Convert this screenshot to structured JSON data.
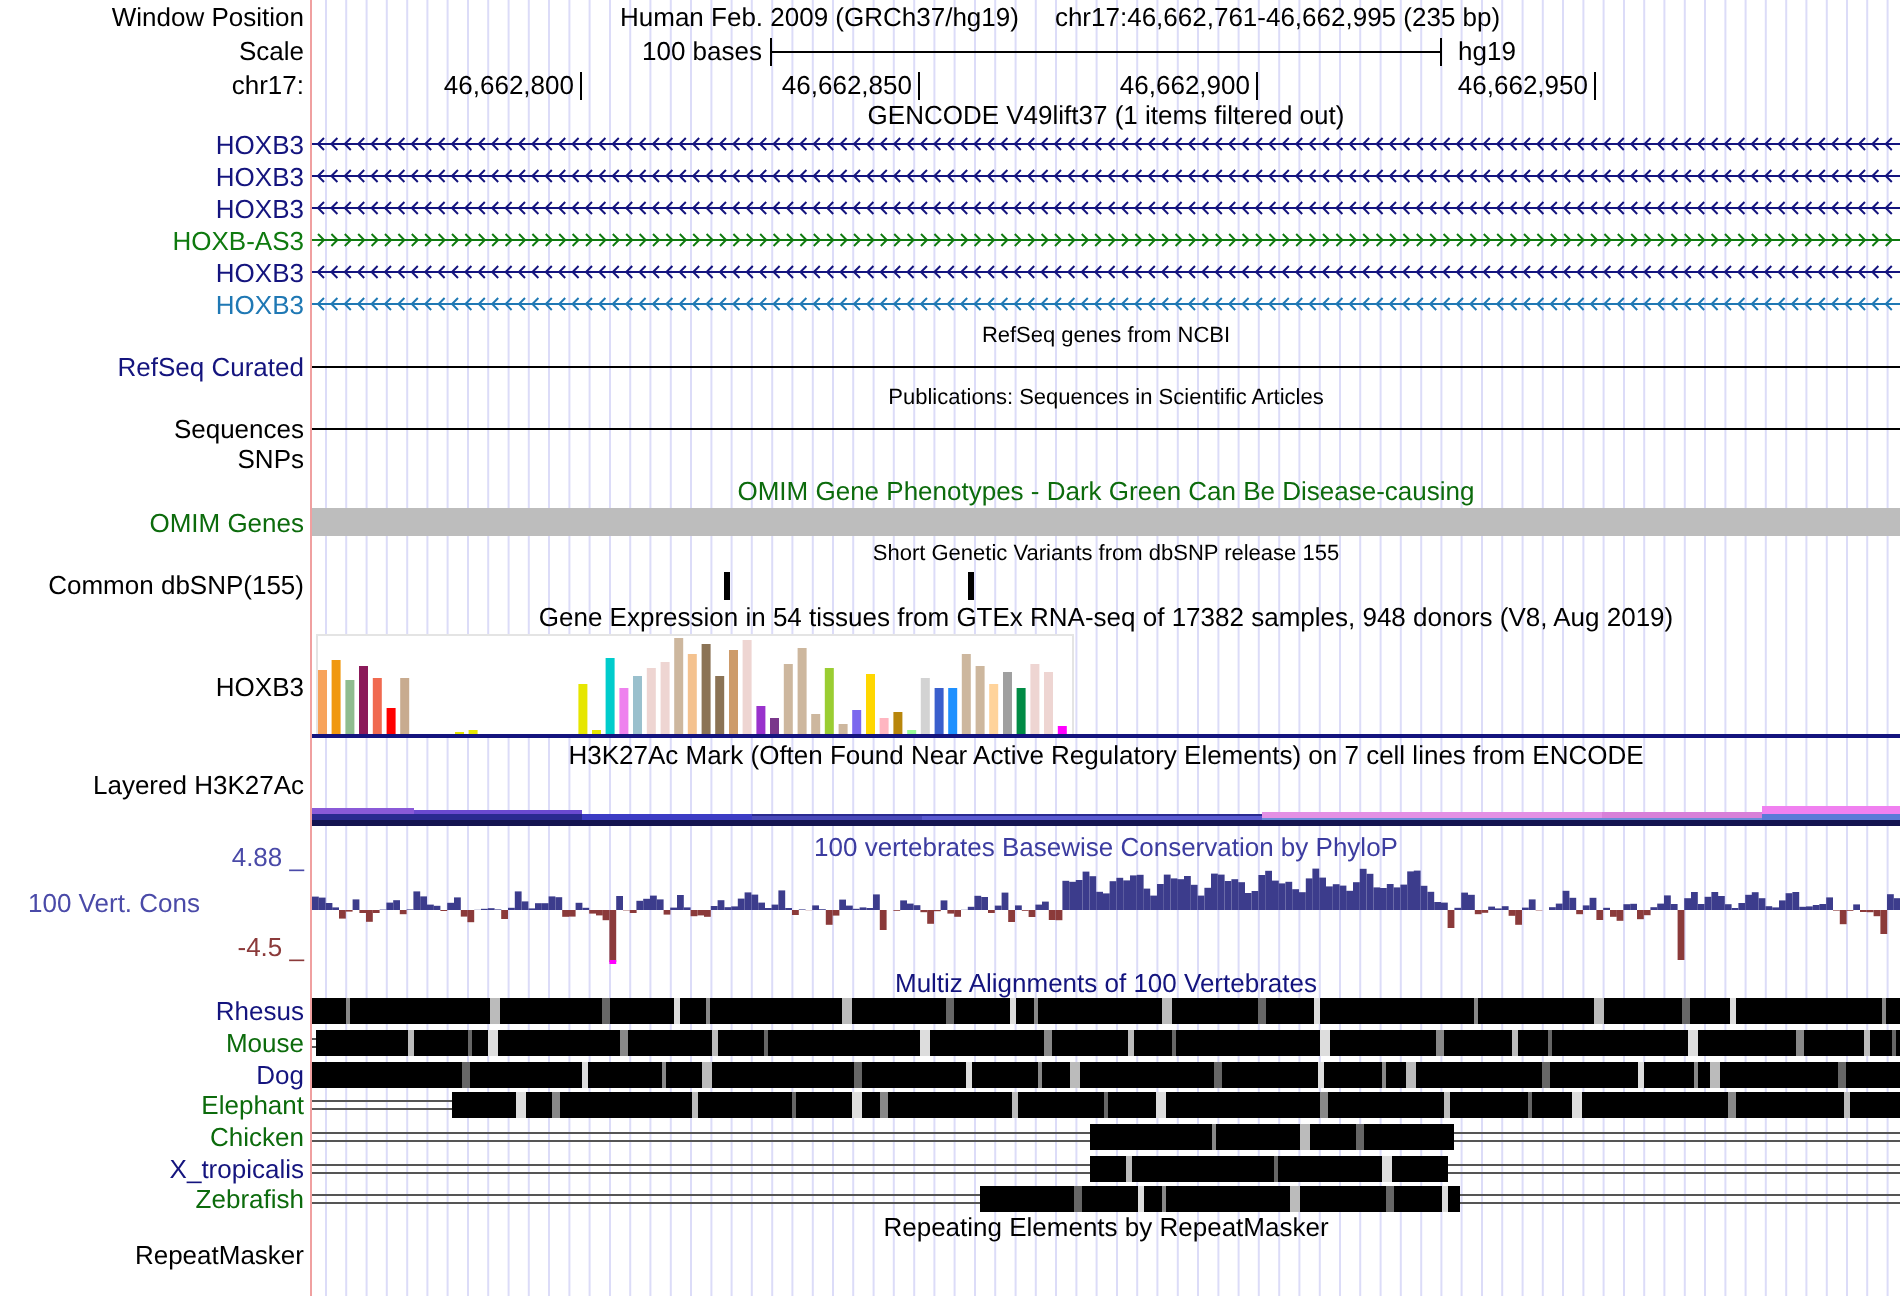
{
  "header": {
    "window_position_label": "Window Position",
    "assembly": "Human Feb. 2009 (GRCh37/hg19)",
    "position": "chr17:46,662,761-46,662,995 (235 bp)",
    "scale_label": "Scale",
    "scale_bar": "100 bases",
    "db": "hg19",
    "chrom_label": "chr17:",
    "ticks": [
      "46,662,800",
      "46,662,850",
      "46,662,900",
      "46,662,950"
    ]
  },
  "tracks": [
    {
      "kind": "genes",
      "title": "GENCODE V49lift37 (1 items filtered out)",
      "genes": [
        {
          "name": "HOXB3",
          "kind": "reverse",
          "color": "#14147e"
        },
        {
          "name": "HOXB3",
          "kind": "reverse",
          "color": "#14147e"
        },
        {
          "name": "HOXB3",
          "kind": "reverse",
          "color": "#14147e"
        },
        {
          "name": "HOXB-AS3",
          "kind": "forward",
          "color": "#0f7a0f"
        },
        {
          "name": "HOXB3",
          "kind": "reverse",
          "color": "#14147e"
        },
        {
          "name": "HOXB3",
          "kind": "reverse",
          "color": "#1f78b4"
        }
      ]
    },
    {
      "kind": "line",
      "title": "RefSeq genes from NCBI",
      "label": "RefSeq Curated",
      "color": "#14147e"
    },
    {
      "kind": "line",
      "title": "Publications: Sequences in Scientific Articles",
      "label": "Sequences",
      "color": "#000000"
    },
    {
      "kind": "empty",
      "label": "SNPs",
      "color": "#000000"
    },
    {
      "kind": "bar",
      "title": "OMIM Gene Phenotypes - Dark Green Can Be Disease-causing",
      "label": "OMIM Genes",
      "color": "#0c6b0c"
    },
    {
      "kind": "snp",
      "title": "Short Genetic Variants from dbSNP release 155",
      "label": "Common dbSNP(155)",
      "color": "#000000"
    },
    {
      "kind": "expression",
      "title": "Gene Expression in 54 tissues from GTEx RNA-seq of 17382 samples, 948 donors (V8, Aug 2019)",
      "label": "HOXB3",
      "color": "#000000"
    },
    {
      "kind": "layered",
      "title": "H3K27Ac Mark (Often Found Near Active Regulatory Elements) on 7 cell lines from ENCODE",
      "label": "Layered H3K27Ac",
      "color": "#000000"
    },
    {
      "kind": "conservation",
      "title": "100 vertebrates Basewise Conservation by PhyloP",
      "label": "100 Vert. Cons",
      "color": "#4a4aa8",
      "max_label": "4.88 _",
      "min_label": "-4.5 _"
    },
    {
      "kind": "multiz",
      "title": "Multiz Alignments of 100 Vertebrates",
      "species": [
        {
          "name": "Rhesus",
          "color": "#14147e"
        },
        {
          "name": "Mouse",
          "color": "#0c6b0c"
        },
        {
          "name": "Dog",
          "color": "#14147e"
        },
        {
          "name": "Elephant",
          "color": "#0c6b0c"
        },
        {
          "name": "Chicken",
          "color": "#0c6b0c"
        },
        {
          "name": "X_tropicalis",
          "color": "#14147e"
        },
        {
          "name": "Zebrafish",
          "color": "#0c6b0c"
        }
      ]
    },
    {
      "kind": "empty",
      "title": "Repeating Elements by RepeatMasker",
      "label": "RepeatMasker",
      "color": "#000000"
    }
  ]
}
